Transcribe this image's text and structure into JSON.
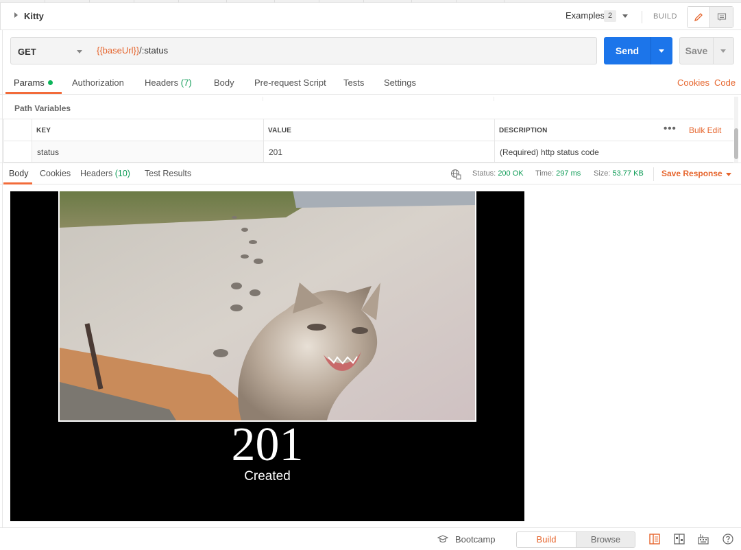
{
  "request": {
    "name": "Kitty",
    "examples_label": "Examples",
    "examples_count": "2",
    "build_label": "BUILD",
    "method": "GET",
    "url_variable": "{{baseUrl}}",
    "url_path": "/:status",
    "send_label": "Send",
    "save_label": "Save"
  },
  "request_tabs": [
    {
      "label": "Params",
      "count": ""
    },
    {
      "label": "Authorization",
      "count": ""
    },
    {
      "label": "Headers",
      "count": "(7)"
    },
    {
      "label": "Body",
      "count": ""
    },
    {
      "label": "Pre-request Script",
      "count": ""
    },
    {
      "label": "Tests",
      "count": ""
    },
    {
      "label": "Settings",
      "count": ""
    }
  ],
  "request_links": {
    "cookies": "Cookies",
    "code": "Code"
  },
  "path_variables": {
    "title": "Path Variables",
    "columns": [
      "KEY",
      "VALUE",
      "DESCRIPTION"
    ],
    "bulk_edit": "Bulk Edit",
    "rows": [
      {
        "key": "status",
        "value": "201",
        "description": "(Required) http status code"
      }
    ]
  },
  "response_tabs": [
    {
      "label": "Body",
      "count": ""
    },
    {
      "label": "Cookies",
      "count": ""
    },
    {
      "label": "Headers",
      "count": "(10)"
    },
    {
      "label": "Test Results",
      "count": ""
    }
  ],
  "response_meta": {
    "status_label": "Status:",
    "status_value": "200 OK",
    "time_label": "Time:",
    "time_value": "297 ms",
    "size_label": "Size:",
    "size_value": "53.77 KB",
    "save_response": "Save Response"
  },
  "response_image": {
    "code": "201",
    "message": "Created"
  },
  "footer": {
    "bootcamp": "Bootcamp",
    "build": "Build",
    "browse": "Browse"
  },
  "colors": {
    "accent": "#e6652d",
    "send_blue": "#1c75ea",
    "ok_green": "#0c9b55"
  }
}
